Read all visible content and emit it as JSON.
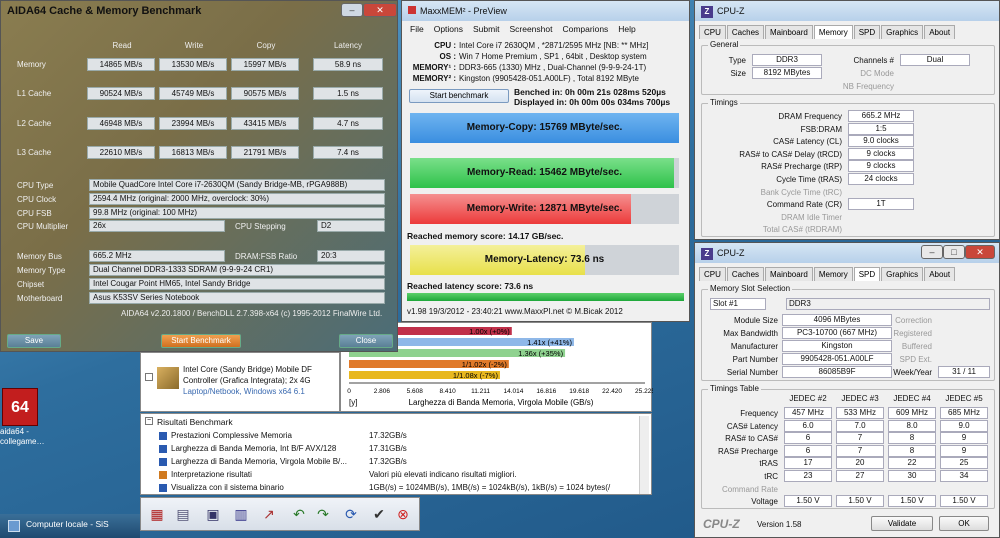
{
  "desktop": {
    "icon_label": "aida64 - collegame…",
    "icon_glyph": "64",
    "taskbar_item": "Computer locale - SiS"
  },
  "aida": {
    "title": "AIDA64 Cache & Memory Benchmark",
    "headers": [
      "Read",
      "Write",
      "Copy",
      "Latency"
    ],
    "rows": [
      {
        "label": "Memory",
        "values": [
          "14865 MB/s",
          "13530 MB/s",
          "15997 MB/s",
          "58.9 ns"
        ]
      },
      {
        "label": "L1 Cache",
        "values": [
          "90524 MB/s",
          "45749 MB/s",
          "90575 MB/s",
          "1.5 ns"
        ]
      },
      {
        "label": "L2 Cache",
        "values": [
          "46948 MB/s",
          "23994 MB/s",
          "43415 MB/s",
          "4.7 ns"
        ]
      },
      {
        "label": "L3 Cache",
        "values": [
          "22610 MB/s",
          "16813 MB/s",
          "21791 MB/s",
          "7.4 ns"
        ]
      }
    ],
    "cpu_type_label": "CPU Type",
    "cpu_type": "Mobile QuadCore Intel Core i7-2630QM  (Sandy Bridge-MB, rPGA988B)",
    "cpu_clock_label": "CPU Clock",
    "cpu_clock": "2594.4 MHz  (original: 2000 MHz, overclock: 30%)",
    "cpu_fsb_label": "CPU FSB",
    "cpu_fsb": "99.8 MHz  (original: 100 MHz)",
    "cpu_mult_label": "CPU Multiplier",
    "cpu_mult": "26x",
    "cpu_stepping_label": "CPU Stepping",
    "cpu_stepping": "D2",
    "mem_bus_label": "Memory Bus",
    "mem_bus": "665.2 MHz",
    "dram_ratio_label": "DRAM:FSB Ratio",
    "dram_ratio": "20:3",
    "mem_type_label": "Memory Type",
    "mem_type": "Dual Channel DDR3-1333 SDRAM  (9-9-9-24 CR1)",
    "chipset_label": "Chipset",
    "chipset": "Intel Cougar Point HM65, Intel Sandy Bridge",
    "mobo_label": "Motherboard",
    "mobo": "Asus K53SV Series Notebook",
    "footer": "AIDA64 v2.20.1800 / BenchDLL 2.7.398-x64  (c) 1995-2012 FinalWire Ltd.",
    "save": "Save",
    "start": "Start Benchmark",
    "close": "Close"
  },
  "maxx": {
    "title": "MaxxMEM² - PreView",
    "menu": [
      "File",
      "Options",
      "Submit",
      "Screenshot",
      "Comparions",
      "Help"
    ],
    "info": [
      {
        "k": "CPU :",
        "v": "Intel Core i7 2630QM , *2871/2595 MHz  [NB: ** MHz]"
      },
      {
        "k": "OS :",
        "v": "Win 7 Home Premium , SP1 , 64bit , Desktop system"
      },
      {
        "k": "MEMORY¹ :",
        "v": "DDR3-665 (1330) MHz , Dual-Channel (9-9-9-24-1T)"
      },
      {
        "k": "MEMORY² :",
        "v": "Kingston (9905428-051.A00LF) , Total 8192 MByte"
      }
    ],
    "start": "Start benchmark",
    "benched": "Benched in: 0h 00m 21s 028ms 520µs",
    "displayed": "Displayed in: 0h 00m 00s 034ms 700µs",
    "copy": "Memory-Copy: 15769 MByte/sec.",
    "read": "Memory-Read: 15462 MByte/sec.",
    "write": "Memory-Write: 12871 MByte/sec.",
    "mem_score": "Reached memory score: 14.17 GB/sec.",
    "latency": "Memory-Latency: 73.6 ns",
    "lat_score": "Reached latency score: 73.6 ns",
    "status": "v1.98    19/3/2012 - 23:40:21    www.MaxxPI.net    © M.Bicak 2012",
    "colors": {
      "copy": "#3a8ee0",
      "read": "#2ec24a",
      "write": "#ec3a3a",
      "latency": "#e8e04a"
    }
  },
  "cpuz1": {
    "title": "CPU-Z",
    "tabs": [
      "CPU",
      "Caches",
      "Mainboard",
      "Memory",
      "SPD",
      "Graphics",
      "About"
    ],
    "active_tab": "Memory",
    "general_label": "General",
    "type_label": "Type",
    "type": "DDR3",
    "size_label": "Size",
    "size": "8192 MBytes",
    "channels_label": "Channels #",
    "channels": "Dual",
    "dc_label": "DC Mode",
    "nb_label": "NB Frequency",
    "timings_label": "Timings",
    "timings": [
      {
        "k": "DRAM Frequency",
        "v": "665.2 MHz"
      },
      {
        "k": "FSB:DRAM",
        "v": "1:5"
      },
      {
        "k": "CAS# Latency (CL)",
        "v": "9.0 clocks"
      },
      {
        "k": "RAS# to CAS# Delay (tRCD)",
        "v": "9 clocks"
      },
      {
        "k": "RAS# Precharge (tRP)",
        "v": "9 clocks"
      },
      {
        "k": "Cycle Time (tRAS)",
        "v": "24 clocks"
      },
      {
        "k": "Bank Cycle Time (tRC)",
        "v": ""
      },
      {
        "k": "Command Rate (CR)",
        "v": "1T"
      },
      {
        "k": "DRAM Idle Timer",
        "v": ""
      },
      {
        "k": "Total CAS# (tRDRAM)",
        "v": ""
      }
    ]
  },
  "cpuz2": {
    "title": "CPU-Z",
    "tabs": [
      "CPU",
      "Caches",
      "Mainboard",
      "Memory",
      "SPD",
      "Graphics",
      "About"
    ],
    "active_tab": "SPD",
    "slot_group": "Memory Slot Selection",
    "slot": "Slot #1",
    "slot_type": "DDR3",
    "fields": [
      {
        "k": "Module Size",
        "v": "4096 MBytes",
        "k2": "Correction",
        "v2": ""
      },
      {
        "k": "Max Bandwidth",
        "v": "PC3-10700 (667 MHz)",
        "k2": "Registered",
        "v2": ""
      },
      {
        "k": "Manufacturer",
        "v": "Kingston",
        "k2": "Buffered",
        "v2": ""
      },
      {
        "k": "Part Number",
        "v": "9905428-051.A00LF",
        "k2": "SPD Ext.",
        "v2": ""
      },
      {
        "k": "Serial Number",
        "v": "86085B9F",
        "k2": "Week/Year",
        "v2": "31 / 11"
      }
    ],
    "timings_group": "Timings Table",
    "jedec": [
      "JEDEC #2",
      "JEDEC #3",
      "JEDEC #4",
      "JEDEC #5"
    ],
    "trows": [
      {
        "k": "Frequency",
        "v": [
          "457 MHz",
          "533 MHz",
          "609 MHz",
          "685 MHz"
        ]
      },
      {
        "k": "CAS# Latency",
        "v": [
          "6.0",
          "7.0",
          "8.0",
          "9.0"
        ]
      },
      {
        "k": "RAS# to CAS#",
        "v": [
          "6",
          "7",
          "8",
          "9"
        ]
      },
      {
        "k": "RAS# Precharge",
        "v": [
          "6",
          "7",
          "8",
          "9"
        ]
      },
      {
        "k": "tRAS",
        "v": [
          "17",
          "20",
          "22",
          "25"
        ]
      },
      {
        "k": "tRC",
        "v": [
          "23",
          "27",
          "30",
          "34"
        ]
      },
      {
        "k": "Command Rate",
        "v": [
          "",
          "",
          "",
          ""
        ]
      },
      {
        "k": "Voltage",
        "v": [
          "1.50 V",
          "1.50 V",
          "1.50 V",
          "1.50 V"
        ]
      }
    ],
    "brand": "CPU-Z",
    "version": "Version 1.58",
    "validate": "Validate",
    "ok": "OK"
  },
  "chart": {
    "bars": [
      {
        "label": "1.00x (+0%)",
        "color": "#c0304a",
        "frac": 0.55
      },
      {
        "label": "1.41x (+41%)",
        "color": "#8fb8e8",
        "frac": 0.76
      },
      {
        "label": "1.36x (+35%)",
        "color": "#8fd28f",
        "frac": 0.73
      },
      {
        "label": "1/1.02x (-2%)",
        "color": "#e07a2a",
        "frac": 0.54
      },
      {
        "label": "1/1.08x (-7%)",
        "color": "#e8b820",
        "frac": 0.51
      }
    ],
    "ticks": [
      "0",
      "2.806",
      "5.608",
      "8.410",
      "11.211",
      "14.014",
      "16.816",
      "19.618",
      "22.420",
      "25.225"
    ],
    "xlabel": "Larghezza di Banda Memoria, Virgola Mobile (GB/s)",
    "unit": "[y]"
  },
  "device": {
    "line1": "Intel Core (Sandy Bridge) Mobile DF",
    "line2": "Controller (Grafica Integrata); 2x 4G",
    "line3": "Laptop/Netbook, Windows x64 6.1"
  },
  "results": {
    "header": "Risultati Benchmark",
    "rows": [
      {
        "k": "Prestazioni Complessive Memoria",
        "v": "17.32GB/s"
      },
      {
        "k": "Larghezza di Banda Memoria, Int B/F AVX/128",
        "v": "17.31GB/s"
      },
      {
        "k": "Larghezza di Banda Memoria, Virgola Mobile B/...",
        "v": "17.32GB/s"
      },
      {
        "k": "Interpretazione risultati",
        "v": "Valori più elevati indicano risultati migliori."
      },
      {
        "k": "Visualizza con il sistema binario",
        "v": "1GB(/s) = 1024MB(/s), 1MB(/s) = 1024kB(/s), 1kB(/s) = 1024 bytes(/"
      }
    ]
  }
}
